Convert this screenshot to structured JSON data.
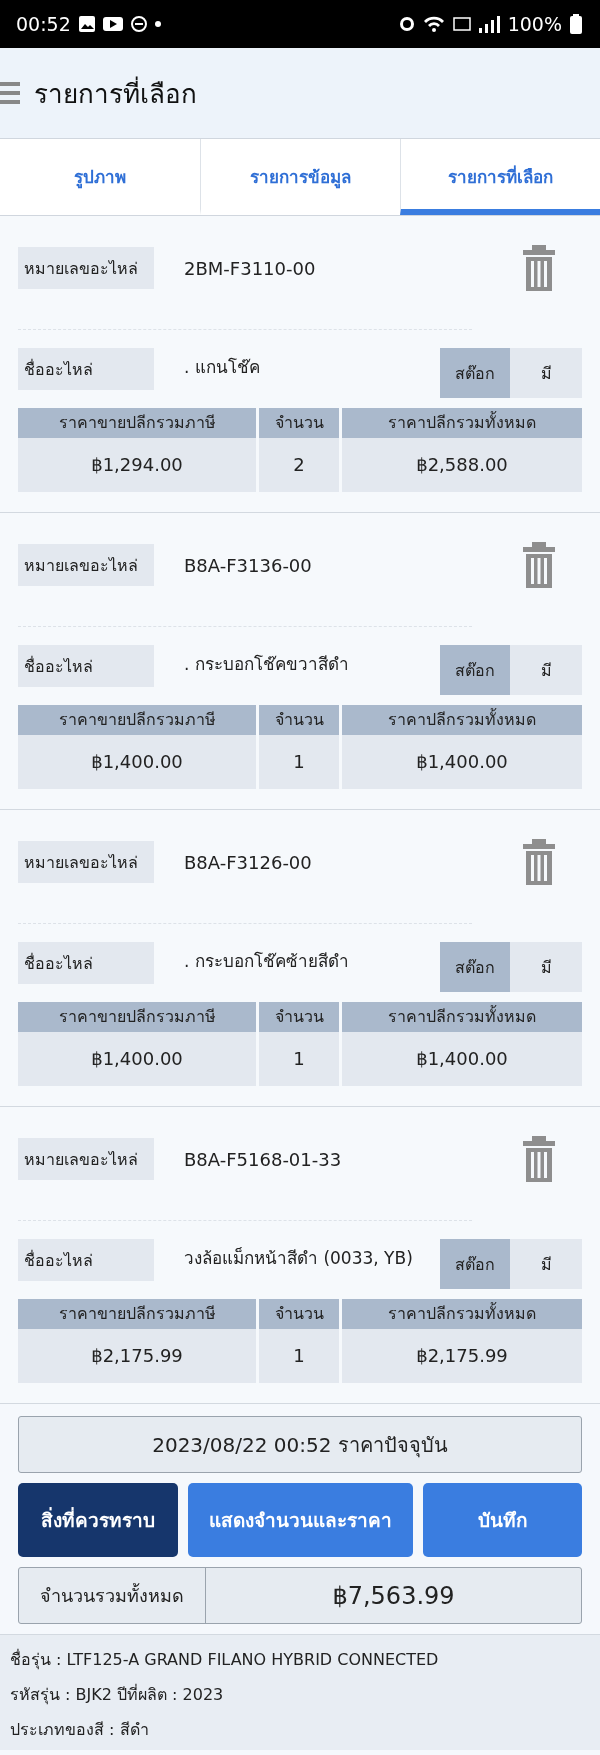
{
  "status_bar": {
    "time": "00:52",
    "battery": "100%"
  },
  "header": {
    "title": "รายการที่เลือก"
  },
  "tabs": [
    {
      "label": "รูปภาพ",
      "selected": false
    },
    {
      "label": "รายการข้อมูล",
      "selected": false
    },
    {
      "label": "รายการที่เลือก",
      "selected": true
    }
  ],
  "items": [
    {
      "part_no_label": "หมายเลขอะไหล่",
      "part_no": "2BM-F3110-00",
      "name_label": "ชื่ออะไหล่",
      "name": ". แกนโช๊ค",
      "stock_label": "สต๊อก",
      "stock": "มี",
      "columns": [
        "ราคาขายปลีกรวมภาษี",
        "จำนวน",
        "ราคาปลีกรวมทั้งหมด"
      ],
      "values": [
        "฿1,294.00",
        "2",
        "฿2,588.00"
      ]
    },
    {
      "part_no_label": "หมายเลขอะไหล่",
      "part_no": "B8A-F3136-00",
      "name_label": "ชื่ออะไหล่",
      "name": ". กระบอกโช๊คขวาสีดำ",
      "stock_label": "สต๊อก",
      "stock": "มี",
      "columns": [
        "ราคาขายปลีกรวมภาษี",
        "จำนวน",
        "ราคาปลีกรวมทั้งหมด"
      ],
      "values": [
        "฿1,400.00",
        "1",
        "฿1,400.00"
      ]
    },
    {
      "part_no_label": "หมายเลขอะไหล่",
      "part_no": "B8A-F3126-00",
      "name_label": "ชื่ออะไหล่",
      "name": ". กระบอกโช๊คซ้ายสีดำ",
      "stock_label": "สต๊อก",
      "stock": "มี",
      "columns": [
        "ราคาขายปลีกรวมภาษี",
        "จำนวน",
        "ราคาปลีกรวมทั้งหมด"
      ],
      "values": [
        "฿1,400.00",
        "1",
        "฿1,400.00"
      ]
    },
    {
      "part_no_label": "หมายเลขอะไหล่",
      "part_no": "B8A-F5168-01-33",
      "name_label": "ชื่ออะไหล่",
      "name": "วงล้อแม็กหน้าสีดำ (0033, YB)",
      "stock_label": "สต๊อก",
      "stock": "มี",
      "columns": [
        "ราคาขายปลีกรวมภาษี",
        "จำนวน",
        "ราคาปลีกรวมทั้งหมด"
      ],
      "values": [
        "฿2,175.99",
        "1",
        "฿2,175.99"
      ]
    }
  ],
  "price_date": "2023/08/22 00:52 ราคาปัจจุบัน",
  "buttons": [
    {
      "label": "สิ่งที่ควรทราบ",
      "kind": "dark"
    },
    {
      "label": "แสดงจำนวนและราคา",
      "kind": "primary"
    },
    {
      "label": "บันทึก",
      "kind": "primary"
    }
  ],
  "total": {
    "label": "จำนวนรวมทั้งหมด",
    "value": "฿7,563.99"
  },
  "info": [
    "ชื่อรุ่น : LTF125-A GRAND FILANO HYBRID CONNECTED",
    "รหัสรุ่น : BJK2 ปีที่ผลิต : 2023",
    "ประเภทของสี : สีดำ"
  ]
}
